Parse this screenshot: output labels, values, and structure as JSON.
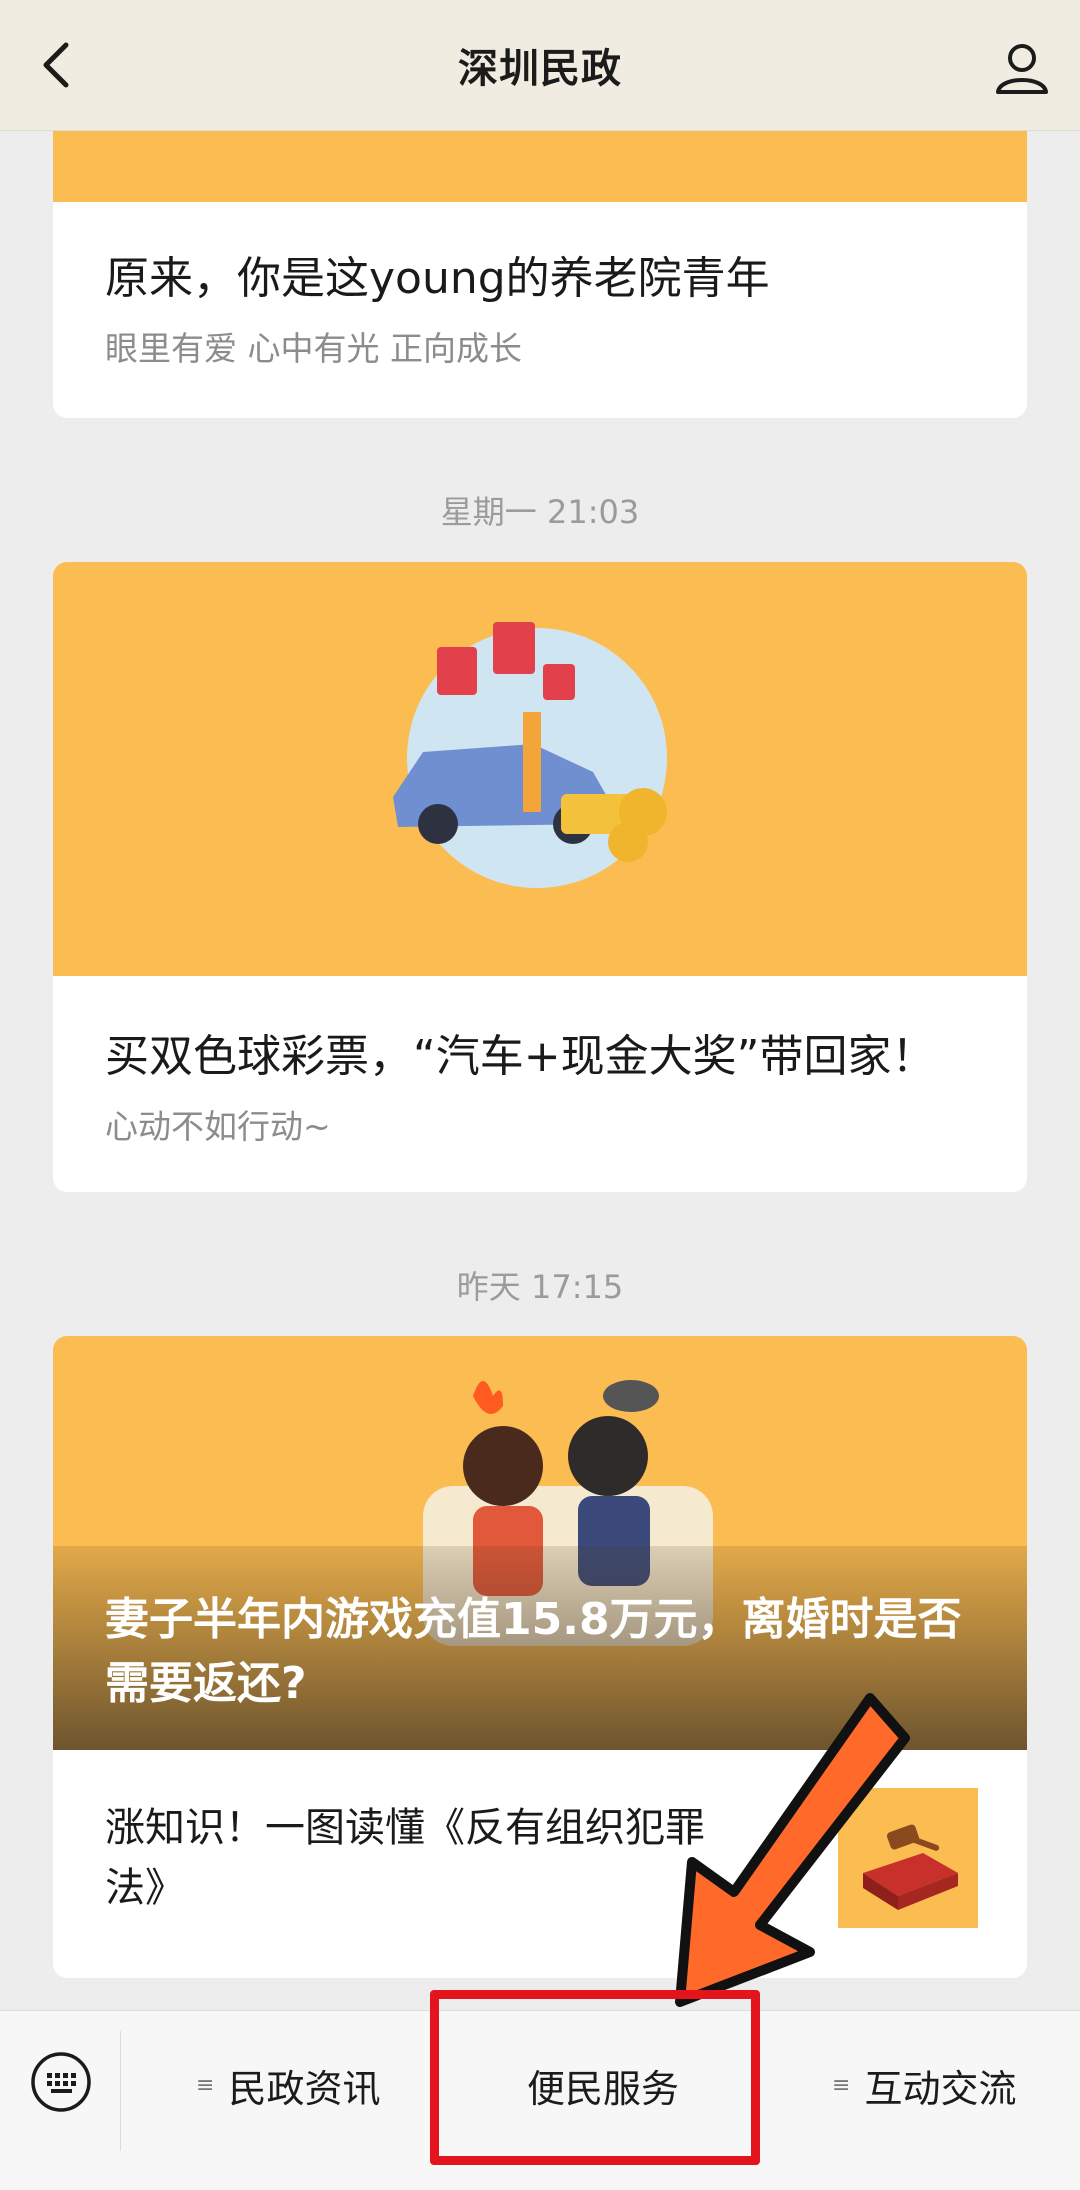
{
  "header": {
    "title": "深圳民政"
  },
  "feed": [
    {
      "title": "原来，你是这young的养老院青年",
      "subtitle": "眼里有爱 心中有光 正向成长"
    },
    {
      "time": "星期一 21:03",
      "title": "买双色球彩票，“汽车+现金大奖”带回家！",
      "subtitle": "心动不如行动~"
    },
    {
      "time": "昨天 17:15",
      "cover_title": "妻子半年内游戏充值15.8万元，离婚时是否需要返还?",
      "sub_item": "涨知识！一图读懂《反有组织犯罪法》"
    }
  ],
  "menu": {
    "items": [
      "民政资讯",
      "便民服务",
      "互动交流"
    ]
  },
  "colors": {
    "accent_yellow": "#fbbd52",
    "arrow_orange": "#ff6a2b",
    "highlight_red": "#e3141b"
  }
}
